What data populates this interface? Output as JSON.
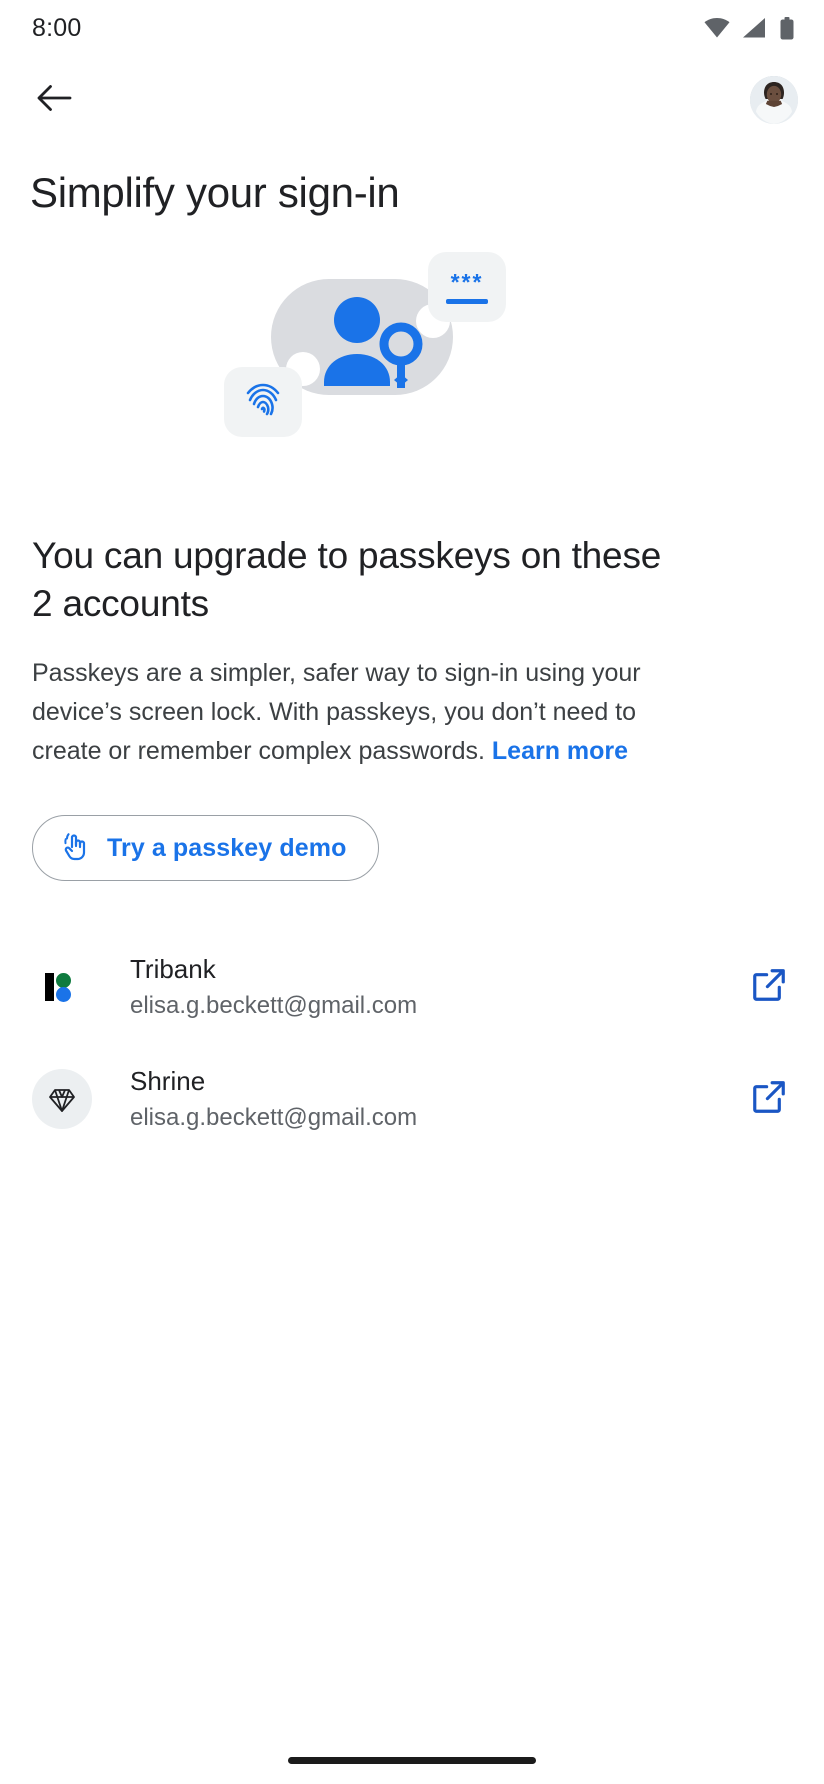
{
  "status_bar": {
    "clock": "8:00",
    "icons": [
      "wifi-icon",
      "cellular-signal-icon",
      "battery-icon"
    ]
  },
  "app_bar": {
    "back_icon": "back-arrow-icon",
    "avatar_label": "Account avatar"
  },
  "page": {
    "title": "Simplify your sign-in"
  },
  "illustration": {
    "password_stars": "***",
    "tiles": [
      "password-tile",
      "fingerprint-tile"
    ],
    "center": "person-with-key-icon",
    "accent_color": "#1a73e8",
    "blob_color": "#dadce0",
    "tile_color": "#f1f3f4"
  },
  "main": {
    "headline": "You can upgrade to passkeys on these 2 accounts",
    "body_part1": "Passkeys are a simpler, safer way to sign-in using your device’s screen lock. With passkeys, you don’t need to create or remember complex passwords. ",
    "learn_more": "Learn more",
    "demo_button": {
      "label": "Try a passkey demo",
      "icon": "touch-gesture-icon",
      "color": "#1a73e8"
    }
  },
  "accounts": [
    {
      "name": "Tribank",
      "email": "elisa.g.beckett@gmail.com",
      "logo": "tribank-logo-icon",
      "action_icon": "open-in-new-icon"
    },
    {
      "name": "Shrine",
      "email": "elisa.g.beckett@gmail.com",
      "logo": "shrine-diamond-icon",
      "action_icon": "open-in-new-icon"
    }
  ],
  "nav_bar": {
    "handle": "home-gesture-handle"
  }
}
